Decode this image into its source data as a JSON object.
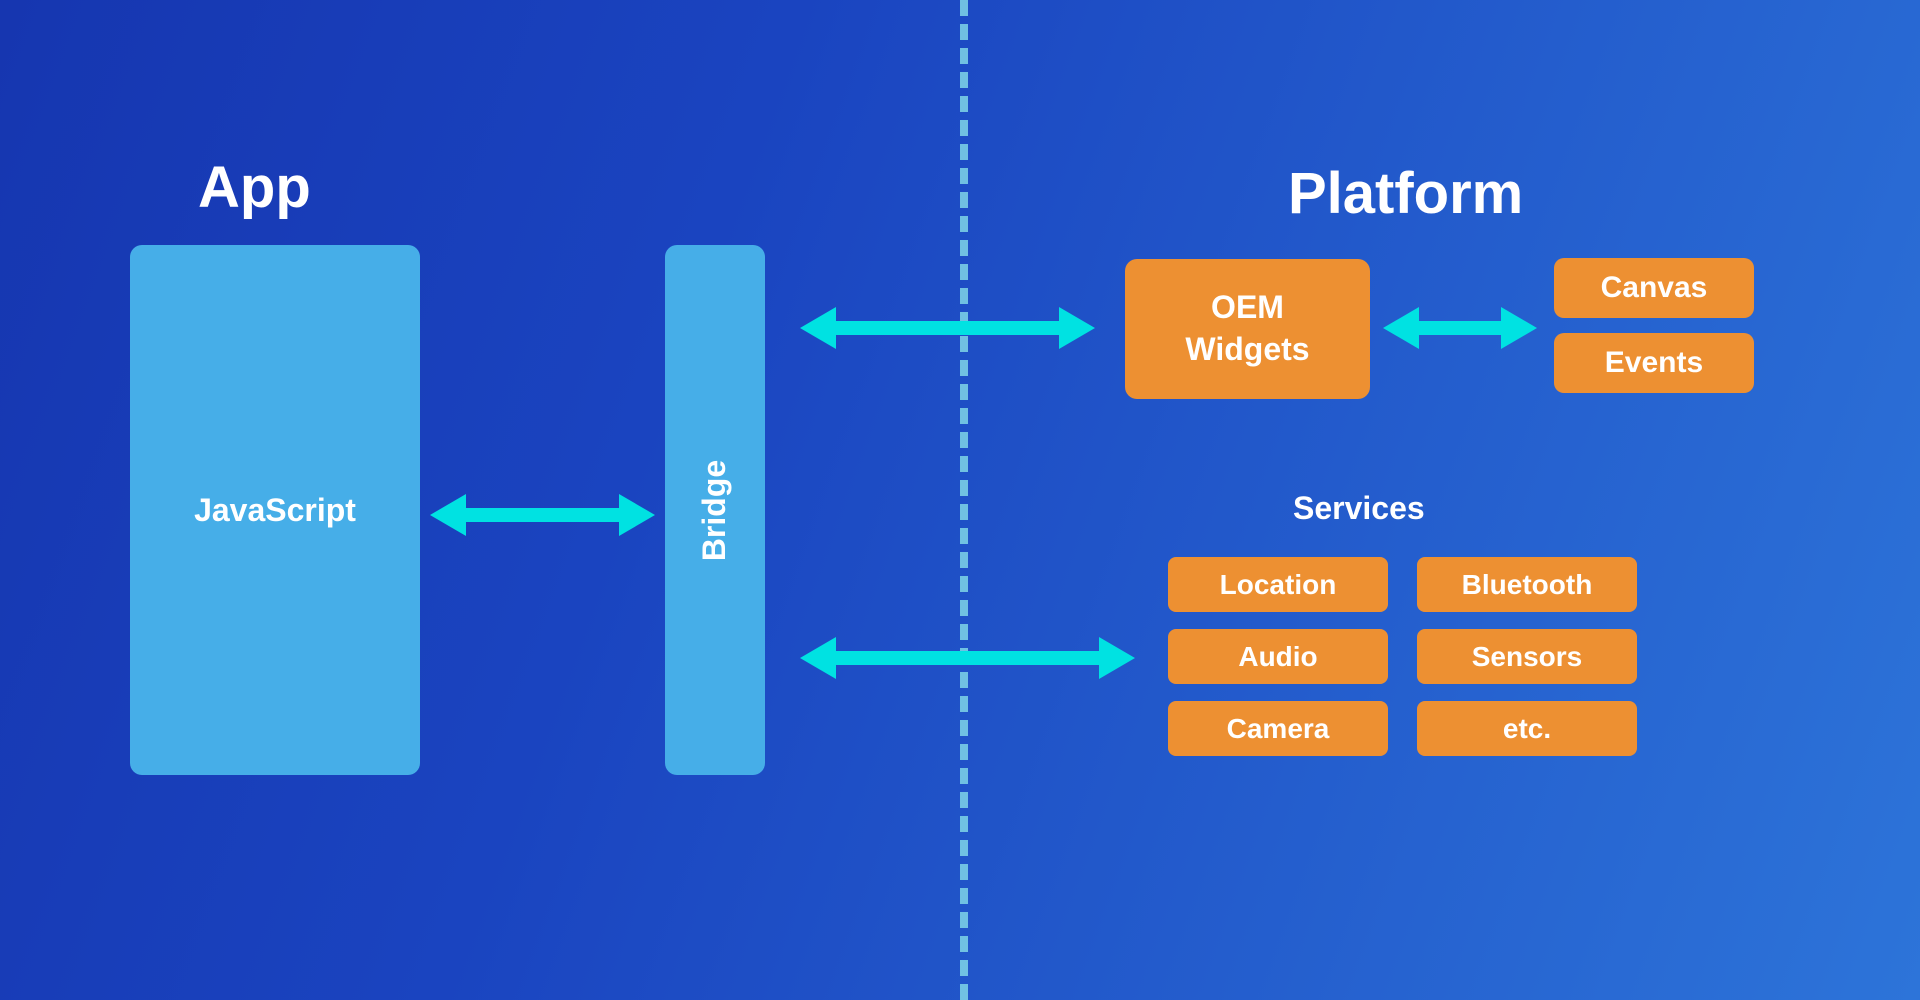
{
  "titles": {
    "app": "App",
    "platform": "Platform"
  },
  "app": {
    "javascript": "JavaScript",
    "bridge": "Bridge"
  },
  "platform": {
    "oem_widgets": "OEM\nWidgets",
    "canvas": "Canvas",
    "events": "Events",
    "services_label": "Services",
    "services": {
      "location": "Location",
      "audio": "Audio",
      "camera": "Camera",
      "bluetooth": "Bluetooth",
      "sensors": "Sensors",
      "etc": "etc."
    }
  },
  "colors": {
    "background_from": "#1636b0",
    "background_to": "#2d74d9",
    "box_blue": "#46aee8",
    "box_orange": "#ed9032",
    "arrow": "#00e2e2",
    "divider": "#7fd5e8"
  }
}
